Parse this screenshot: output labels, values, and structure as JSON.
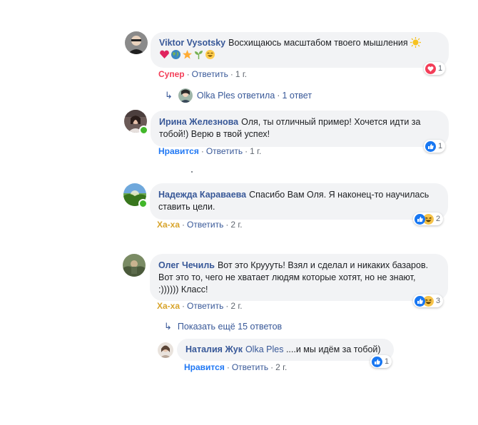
{
  "comments": [
    {
      "author": "Viktor Vysotsky",
      "text": "Восхищаюсь масштабом твоего мышления",
      "emoji_line1": [
        "sun-emoji"
      ],
      "emoji_line2": [
        "heart-emoji",
        "globe-emoji",
        "star-emoji",
        "seedling-emoji",
        "smile-emoji"
      ],
      "reaction_label": "Супер",
      "reply": "Ответить",
      "time": "1 г.",
      "reaction_count": "1",
      "reaction_icons": [
        "love"
      ],
      "replies_summary": {
        "author": "Olka Ples",
        "text": "ответила",
        "count": "1 ответ"
      }
    },
    {
      "author": "Ирина Железнова",
      "line1": "Оля, ты отличный пример! Хочется идти за",
      "line2": "тобой!) Верю в твой успех!",
      "reaction_label": "Нравится",
      "reply": "Ответить",
      "time": "1 г.",
      "reaction_count": "1",
      "reaction_icons": [
        "like"
      ]
    },
    {
      "author": "Надежда Караваева",
      "line1": "Спасибо Вам Оля. Я наконец-то научилась",
      "line2": "ставить цели.",
      "reaction_label": "Ха-ха",
      "reply": "Ответить",
      "time": "2 г.",
      "reaction_count": "2",
      "reaction_icons": [
        "like",
        "haha"
      ]
    },
    {
      "author": "Олег Чечиль",
      "line1": "Вот это Круууть! Взял и сделал и никаких базаров.",
      "line2": "Вот это то, чего не хватает людям которые хотят, но не знают,",
      "line3": ":)))))) Класс!",
      "reaction_label": "Ха-ха",
      "reply": "Ответить",
      "time": "2 г.",
      "reaction_count": "3",
      "reaction_icons": [
        "like",
        "haha"
      ],
      "more_replies": "Показать ещё 15 ответов",
      "nested_reply": {
        "author": "Наталия Жук",
        "tag": "Olka Ples",
        "text": "....и мы идём за тобой)",
        "reaction_label": "Нравится",
        "reply": "Ответить",
        "time": "2 г.",
        "reaction_count": "1",
        "reaction_icons": [
          "like"
        ]
      }
    }
  ],
  "separator": "·",
  "colors": {
    "link": "#385898",
    "meta": "#606770",
    "bubble": "#f2f3f5",
    "love": "#f33e58",
    "haha": "#d8a42b",
    "like_label": "#2078f4",
    "like_icon": "#1877f2",
    "online": "#42b72a"
  }
}
